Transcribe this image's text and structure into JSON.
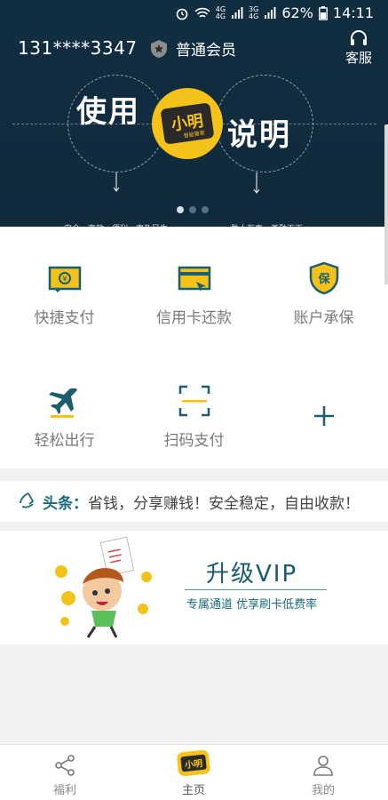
{
  "status_bar": {
    "network_small_top": "4G",
    "network_small_bottom": "3G",
    "battery": "62%",
    "time": "14:11"
  },
  "header": {
    "phone": "131****3347",
    "member_level": "普通会员",
    "service_label": "客服"
  },
  "banner": {
    "left_text": "使用",
    "right_text": "说明",
    "logo_text": "小明",
    "logo_sub": "智能管家",
    "caption_left": "安全、高效、便利、惠及民生",
    "caption_right": "助人互惠、善融天下",
    "active_dot": 0
  },
  "services": [
    {
      "label": "快捷支付",
      "icon": "wallet-icon"
    },
    {
      "label": "信用卡还款",
      "icon": "credit-card-icon"
    },
    {
      "label": "账户承保",
      "icon": "shield-icon"
    },
    {
      "label": "轻松出行",
      "icon": "airplane-icon"
    },
    {
      "label": "扫码支付",
      "icon": "scan-icon"
    },
    {
      "label": "",
      "icon": "plus-icon"
    }
  ],
  "news": {
    "label": "头条：",
    "text": "省钱，分享赚钱！安全稳定，自由收款！"
  },
  "vip": {
    "title": "升级VIP",
    "subtitle": "专属通道 优享刷卡低费率"
  },
  "bottom_nav": {
    "left": "福利",
    "center": "主页",
    "right": "我的",
    "logo_text": "小明"
  },
  "colors": {
    "header_bg": "#112d40",
    "accent_yellow": "#f5c21a",
    "teal": "#1a6a7b"
  }
}
